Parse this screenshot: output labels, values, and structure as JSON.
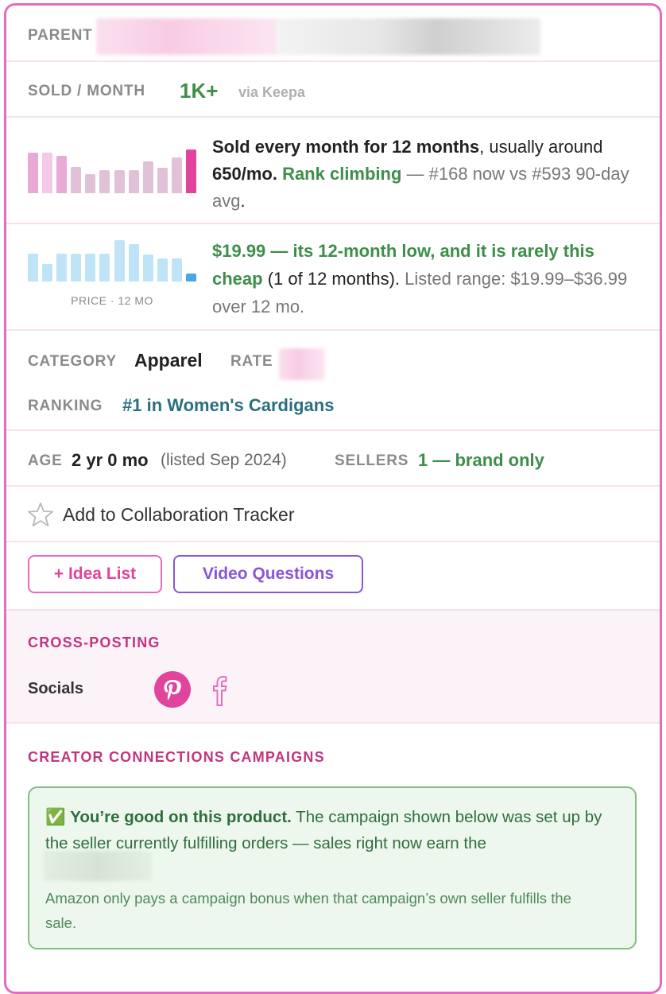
{
  "parent": {
    "label": "PARENT"
  },
  "sold": {
    "label": "SOLD / MONTH",
    "value": "1K+",
    "source": "via Keepa"
  },
  "sales_summary": {
    "t1": "Sold every month for 12 months",
    "t2": ", usually around ",
    "t3": "650/mo.",
    "t4": " ",
    "t5": "Rank climbing",
    "t6": " — #168 now vs #593 90-day avg",
    "t7": "."
  },
  "price_summary": {
    "t1": "$19.99 — its 12-month low, and it is rarely this cheap",
    "t2": " (1 of 12 months). ",
    "t3": "Listed range: $19.99–$36.99 over 12 mo."
  },
  "price_chart_caption": "PRICE · 12 MO",
  "category": {
    "label": "CATEGORY",
    "value": "Apparel",
    "rate_label": "RATE"
  },
  "ranking": {
    "label": "RANKING",
    "value": "#1 in Women's Cardigans"
  },
  "age": {
    "label": "AGE",
    "value": "2 yr 0 mo",
    "listed": "(listed Sep 2024)",
    "sellers_label": "SELLERS",
    "sellers_value": "1 — brand only"
  },
  "tracker": {
    "icon": "star-outline-icon",
    "label": "Add to Collaboration Tracker"
  },
  "buttons": {
    "idea_list": "+ Idea List",
    "video_questions": "Video Questions"
  },
  "cross_posting": {
    "title": "CROSS-POSTING",
    "socials_label": "Socials",
    "icons": [
      "pinterest-icon",
      "facebook-icon"
    ]
  },
  "creator_connections": {
    "title": "CREATOR CONNECTIONS CAMPAIGNS",
    "check": "✅",
    "bold": "You’re good on this product.",
    "text": " The campaign shown below was set up by the seller currently fulfilling orders — sales right now earn the",
    "note": "Amazon only pays a campaign bonus when that campaign’s own seller fulfills the sale."
  },
  "colors": {
    "accent_pink": "#e46cc0",
    "green": "#3e8e4a",
    "link_teal": "#2a6f7f",
    "purple": "#8a55d6"
  },
  "chart_data": [
    {
      "type": "bar",
      "values": [
        7,
        7,
        6.5,
        4.6,
        3.3,
        4,
        4,
        4,
        5.5,
        4.4,
        6.2,
        7.6
      ],
      "highlight_index": 11,
      "colors": [
        "#e8a9d4",
        "#f3c9e6",
        "#e8a9d4",
        "#e1c1d8",
        "#e1c1d8",
        "#e1c1d8",
        "#e1c1d8",
        "#e1c1d8",
        "#e1c1d8",
        "#e1c1d8",
        "#e1c1d8",
        "#e0449d"
      ]
    },
    {
      "type": "bar",
      "caption": "PRICE · 12 MO",
      "values": [
        6.8,
        4.2,
        6.8,
        6.8,
        6.8,
        6.8,
        10,
        9,
        6.6,
        5.6,
        5.6,
        2
      ],
      "highlight_index": 11,
      "colors": [
        "#bfe3f7",
        "#bfe3f7",
        "#bfe3f7",
        "#bfe3f7",
        "#bfe3f7",
        "#bfe3f7",
        "#bfe3f7",
        "#bfe3f7",
        "#bfe3f7",
        "#bfe3f7",
        "#bfe3f7",
        "#4aa8e0"
      ]
    }
  ]
}
